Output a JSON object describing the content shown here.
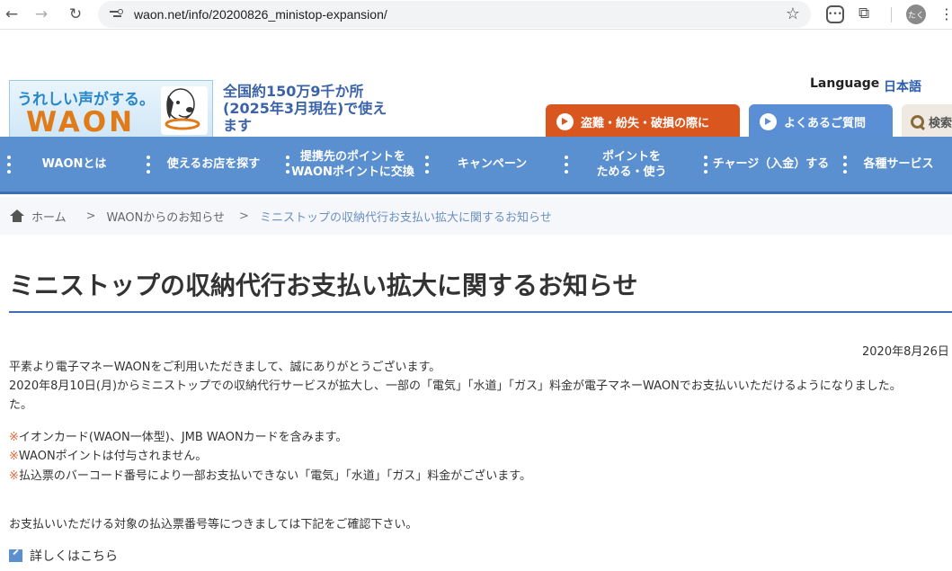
{
  "browser": {
    "url": "waon.net/info/20200826_ministop-expansion/",
    "avatar_text": "たく"
  },
  "header": {
    "logo_tagline": "うれしい声がする。",
    "logo_wordmark": "WAON",
    "claim": "全国約150万9千か所(2025年3月現在)で使えます",
    "language_label": "Language",
    "language_value": "日本語",
    "buttons": {
      "theft": "盗難・紛失・破損の際に",
      "faq": "よくあるご質問",
      "search": "検索"
    }
  },
  "nav": {
    "items": [
      "WAONとは",
      "使えるお店を探す",
      "提携先のポイントを\nWAONポイントに交換",
      "キャンペーン",
      "ポイントを\nためる・使う",
      "チャージ（入金）する",
      "各種サービス"
    ]
  },
  "breadcrumb": {
    "home": "ホーム",
    "level1": "WAONからのお知らせ",
    "current": "ミニストップの収納代行お支払い拡大に関するお知らせ"
  },
  "article": {
    "title": "ミニストップの収納代行お支払い拡大に関するお知らせ",
    "date": "2020年8月26日",
    "greeting": "平素より電子マネーWAONをご利用いただきまして、誠にありがとうございます。",
    "body_line1": "2020年8月10日(月)からミニストップでの収納代行サービスが拡大し、一部の「電気」「水道」「ガス」料金が電子マネーWAONでお支払いいただけるようになりました。",
    "body_line2": "た。",
    "note_mark": "※",
    "notes": [
      "イオンカード(WAON一体型)、JMB WAONカードを含みます。",
      "WAONポイントは付与されません。",
      "払込票のバーコード番号により一部お支払いできない「電気」「水道」「ガス」料金がございます。"
    ],
    "confirm": "お支払いいただける対象の払込票番号等につきましては下記をご確認下さい。",
    "details_link": "詳しくはこちら"
  }
}
